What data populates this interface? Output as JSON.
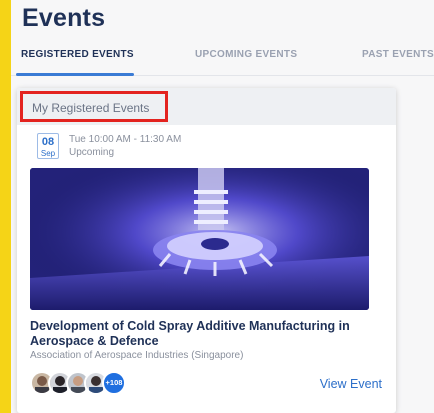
{
  "page": {
    "title": "Events"
  },
  "tabs": [
    {
      "label": "REGISTERED EVENTS",
      "active": true
    },
    {
      "label": "UPCOMING EVENTS",
      "active": false
    },
    {
      "label": "PAST EVENTS",
      "active": false
    }
  ],
  "section": {
    "label": "My Registered Events"
  },
  "event": {
    "date_day": "08",
    "date_month": "Sep",
    "time": "Tue 10:00 AM - 11:30 AM",
    "status": "Upcoming",
    "title": "Development of Cold Spray Additive Manufacturing in Aerospace & Defence",
    "organizer": "Association of Aerospace Industries (Singapore)",
    "attendees_extra": "+108",
    "view_label": "View Event"
  },
  "colors": {
    "accent_yellow": "#f5d417",
    "tab_active_underline": "#3a7bd5",
    "highlight_box": "#e3231f",
    "link_blue": "#2c6fc9"
  }
}
